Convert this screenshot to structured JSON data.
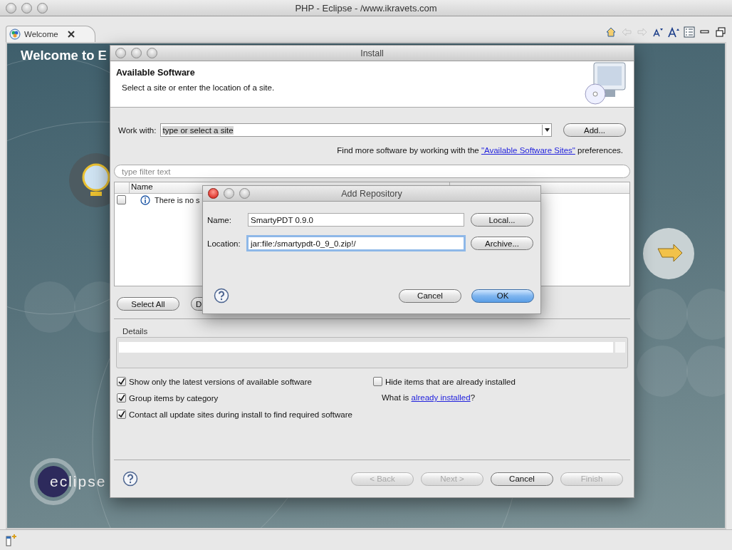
{
  "window": {
    "title": "PHP - Eclipse - /www.ikravets.com"
  },
  "editor_tabs": [
    {
      "label": "Welcome",
      "selected": true
    }
  ],
  "welcome": {
    "heading": "Welcome to E",
    "logo": "eclipse"
  },
  "install_dialog": {
    "title": "Install",
    "header": {
      "title": "Available Software",
      "subtitle": "Select a site or enter the location of a site."
    },
    "work_with": {
      "label": "Work with:",
      "value": "type or select a site"
    },
    "add_button": "Add...",
    "sites_note": {
      "before": "Find more software by working with the ",
      "link": "\"Available Software Sites\"",
      "after": " preferences."
    },
    "filter": {
      "placeholder": "type filter text"
    },
    "table": {
      "columns": [
        "Name"
      ],
      "rows": [
        {
          "checked": false,
          "text": "There is no s"
        }
      ]
    },
    "list_buttons": [
      "Select All",
      "D"
    ],
    "details": {
      "label": "Details"
    },
    "options_left": [
      {
        "label": "Show only the latest versions of available software",
        "checked": true
      },
      {
        "label": "Group items by category",
        "checked": true
      },
      {
        "label": "Contact all update sites during install to find required software",
        "checked": true
      }
    ],
    "options_right": [
      {
        "label": "Hide items that are already installed",
        "checked": false
      }
    ],
    "installed_note": {
      "before": "What is ",
      "link": "already installed",
      "after": "?"
    },
    "buttons": [
      {
        "label": "< Back",
        "disabled": true
      },
      {
        "label": "Next >",
        "disabled": true
      },
      {
        "label": "Cancel",
        "disabled": false
      },
      {
        "label": "Finish",
        "disabled": true
      }
    ]
  },
  "add_repository": {
    "title": "Add Repository",
    "fields": [
      {
        "label": "Name:",
        "value": "SmartyPDT 0.9.0",
        "button": "Local...",
        "focused": false
      },
      {
        "label": "Location:",
        "value": "jar:file:/smartypdt-0_9_0.zip!/",
        "button": "Archive...",
        "focused": true
      }
    ],
    "buttons": [
      {
        "label": "Cancel",
        "default": false
      },
      {
        "label": "OK",
        "default": true
      }
    ]
  }
}
